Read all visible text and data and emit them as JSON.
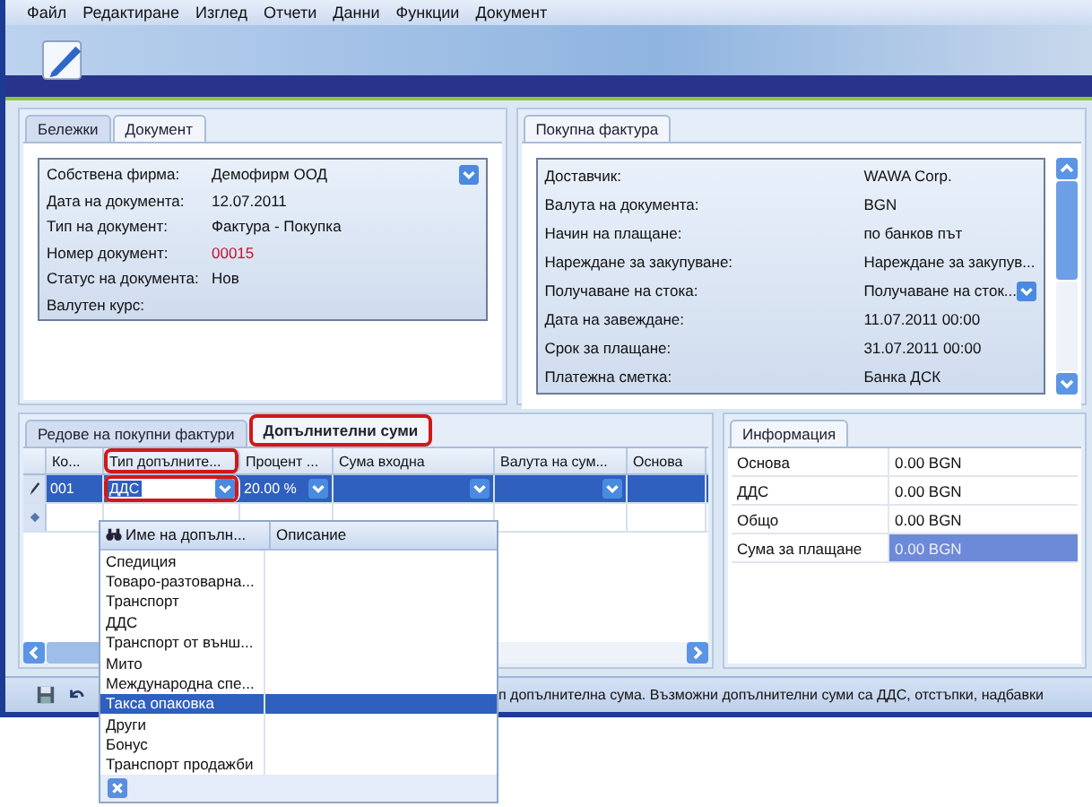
{
  "menu": [
    "Файл",
    "Редактиране",
    "Изглед",
    "Отчети",
    "Данни",
    "Функции",
    "Документ"
  ],
  "document_panel": {
    "tabs": [
      {
        "label": "Бележки",
        "selected": false
      },
      {
        "label": "Документ",
        "selected": true
      }
    ],
    "fields": [
      {
        "label": "Собствена фирма:",
        "value": "Демофирм ООД",
        "dropdown": true,
        "highlighted": false
      },
      {
        "label": "Дата на документа:",
        "value": "12.07.2011",
        "dropdown": false,
        "highlighted": false
      },
      {
        "label": "Тип на документ:",
        "value": "Фактура - Покупка",
        "dropdown": false,
        "highlighted": false
      },
      {
        "label": "Номер документ:",
        "value": "00015",
        "dropdown": false,
        "highlighted": true
      },
      {
        "label": "Статус на документа:",
        "value": "Нов",
        "dropdown": false,
        "highlighted": false
      },
      {
        "label": "Валутен курс:",
        "dropdown": false
      }
    ]
  },
  "invoice_panel": {
    "tabs": [
      {
        "label": "Покупна фактура",
        "selected": true
      }
    ],
    "fields": [
      {
        "label": "Доставчик:",
        "value": "WAWA Corp.",
        "dropdown": false
      },
      {
        "label": "Валута на документа:",
        "value": "BGN",
        "dropdown": false
      },
      {
        "label": "Начин на плащане:",
        "value": "по банков път",
        "dropdown": false
      },
      {
        "label": "Нареждане за закупуване:",
        "value": "Нареждане за закупув...",
        "dropdown": false
      },
      {
        "label": "Получаване на стока:",
        "value": "Получаване на сток...",
        "dropdown": true
      },
      {
        "label": "Дата на завеждане:",
        "value": "11.07.2011 00:00",
        "dropdown": false
      },
      {
        "label": "Срок за плащане:",
        "value": "31.07.2011 00:00",
        "dropdown": false
      },
      {
        "label": "Платежна сметка:",
        "value": "Банка ДСК",
        "dropdown": false
      }
    ]
  },
  "lines_panel": {
    "tabs": [
      {
        "label": "Редове на покупни фактури",
        "selected": false,
        "highlighted": false
      },
      {
        "label": "Допълнителни суми",
        "selected": true,
        "highlighted": true
      }
    ],
    "columns": [
      {
        "label": "Ко...",
        "highlighted": false
      },
      {
        "label": "Тип допълните...",
        "highlighted": true
      },
      {
        "label": "Процент ...",
        "highlighted": false
      },
      {
        "label": "Сума входна",
        "highlighted": false
      },
      {
        "label": "Валута на сум...",
        "highlighted": false
      },
      {
        "label": "Основа",
        "highlighted": false
      }
    ],
    "rows": [
      {
        "kind": "edit",
        "selected": true,
        "cells": [
          {
            "value": "001",
            "dropdown": false
          },
          {
            "value": "ДДС",
            "dropdown": true,
            "highlighted": true
          },
          {
            "value": "20.00 %",
            "dropdown": true
          },
          {
            "dropdown": true
          },
          {
            "dropdown": true
          },
          {
            "dropdown": false
          }
        ]
      },
      {
        "kind": "new",
        "selected": false,
        "cells": [
          {
            "dropdown": false
          },
          {
            "dropdown": false
          },
          {
            "dropdown": false
          },
          {
            "dropdown": false
          },
          {
            "dropdown": false
          },
          {
            "dropdown": false
          }
        ]
      }
    ]
  },
  "info_panel": {
    "tabs": [
      {
        "label": "Информация",
        "selected": true
      }
    ],
    "rows": [
      {
        "label": "Основа",
        "value": "0.00 BGN",
        "selected": false
      },
      {
        "label": "ДДС",
        "value": "0.00 BGN",
        "selected": false
      },
      {
        "label": "Общо",
        "value": "0.00 BGN",
        "selected": false
      },
      {
        "label": "Сума за плащане",
        "value": "0.00 BGN",
        "selected": true
      }
    ]
  },
  "dropdown_list": {
    "columns": [
      "Име на допълн...",
      "Описание"
    ],
    "items": [
      {
        "label": "Спедиция",
        "selected": false
      },
      {
        "label": "Товаро-разтоварна...",
        "selected": false
      },
      {
        "label": "Транспорт",
        "selected": false
      },
      {
        "label": "ДДС",
        "selected": false
      },
      {
        "label": "Транспорт от външ...",
        "selected": false
      },
      {
        "label": "Мито",
        "selected": false
      },
      {
        "label": "Международна спе...",
        "selected": false
      },
      {
        "label": "Такса опаковка",
        "selected": true
      },
      {
        "label": "Други",
        "selected": false
      },
      {
        "label": "Бонус",
        "selected": false
      },
      {
        "label": "Транспорт продажби",
        "selected": false
      }
    ]
  },
  "status_bar": {
    "text": "п допълнителна сума. Възможни допълнителни суми са ДДС, отстъпки, надбавки"
  }
}
